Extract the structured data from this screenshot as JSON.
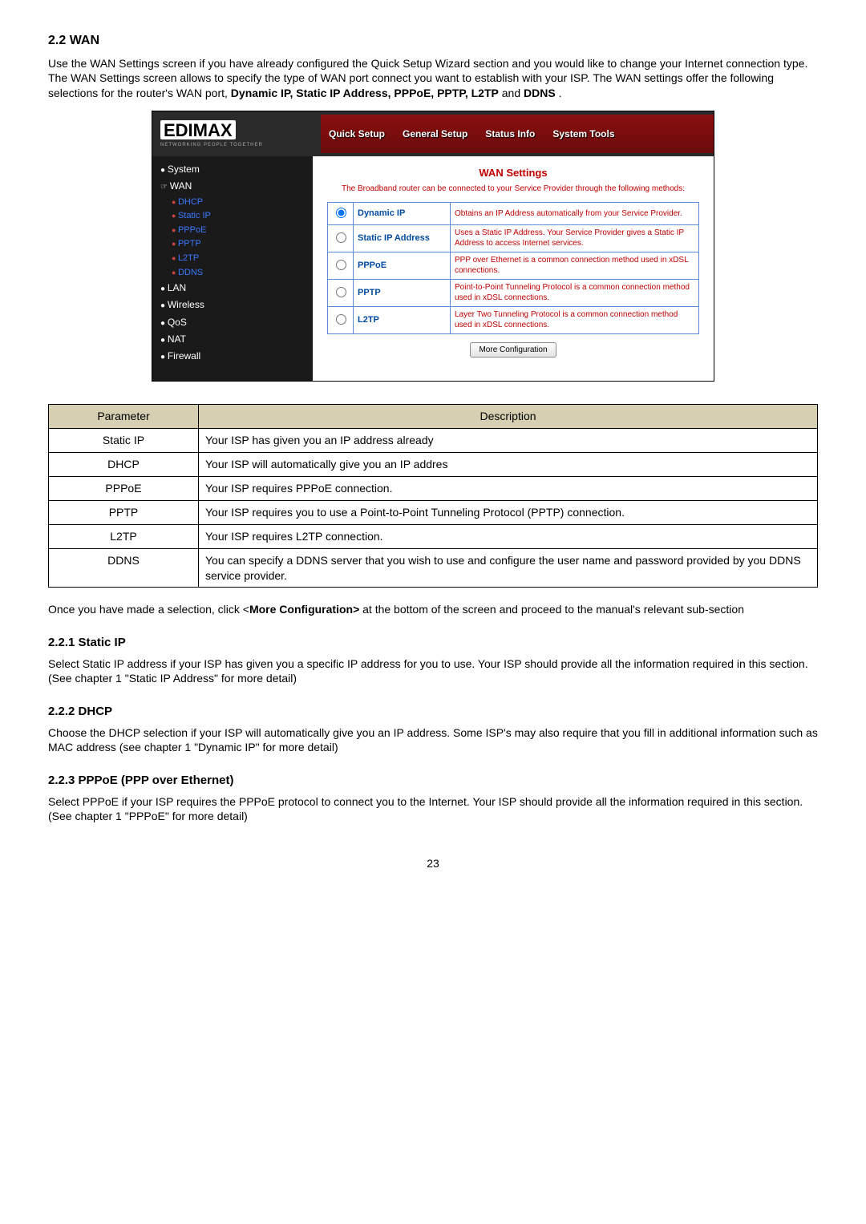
{
  "headings": {
    "wan": "2.2 WAN",
    "static_ip": "2.2.1 Static IP",
    "dhcp": "2.2.2 DHCP",
    "pppoe": "2.2.3 PPPoE (PPP over Ethernet)"
  },
  "paragraphs": {
    "wan_intro_1": "Use the WAN Settings screen if you have already configured the Quick Setup Wizard section and you would like to change your Internet connection type. The WAN Settings screen allows to specify the type of WAN port connect you want to establish with your ISP. The WAN settings offer the following selections for the router's WAN port, ",
    "wan_intro_bold": "Dynamic IP, Static IP Address, PPPoE, PPTP, L2TP",
    "wan_intro_and": " and ",
    "wan_intro_ddns": "DDNS",
    "wan_intro_end": ".",
    "after_table_1": "Once you have made a selection, click <",
    "after_table_bold": "More Configuration>",
    "after_table_2": " at the bottom of the screen and proceed to the manual's relevant sub-section",
    "static_ip_text": "Select Static IP address if your ISP has given you a specific IP address for you to use. Your ISP should provide all the information required in this section. (See chapter 1 \"Static IP Address\" for more detail)",
    "dhcp_text": "Choose the DHCP selection if your ISP will automatically give you an IP address. Some ISP's may also require that you fill in additional information such as MAC address (see chapter 1 \"Dynamic IP\" for more detail)",
    "pppoe_text": "Select PPPoE if your ISP requires the PPPoE protocol to connect you to the Internet. Your ISP should provide all the information required in this section. (See chapter 1 \"PPPoE\" for more detail)"
  },
  "router_ui": {
    "logo_main": "EDIMAX",
    "logo_sub": "NETWORKING PEOPLE TOGETHER",
    "topnav": [
      "Quick Setup",
      "General Setup",
      "Status Info",
      "System Tools"
    ],
    "sidebar": {
      "system": "System",
      "wan": "WAN",
      "subs": [
        "DHCP",
        "Static IP",
        "PPPoE",
        "PPTP",
        "L2TP",
        "DDNS"
      ],
      "lan": "LAN",
      "wireless": "Wireless",
      "qos": "QoS",
      "nat": "NAT",
      "firewall": "Firewall"
    },
    "panel": {
      "title": "WAN Settings",
      "subtitle": "The Broadband router can be connected to your Service Provider through the following methods:",
      "rows": [
        {
          "label": "Dynamic IP",
          "desc": "Obtains an IP Address automatically from your Service Provider.",
          "checked": true
        },
        {
          "label": "Static IP Address",
          "desc": "Uses a Static IP Address. Your Service Provider gives a Static IP Address to access Internet services.",
          "checked": false
        },
        {
          "label": "PPPoE",
          "desc": "PPP over Ethernet is a common connection method used in xDSL connections.",
          "checked": false
        },
        {
          "label": "PPTP",
          "desc": "Point-to-Point Tunneling Protocol is a common connection method used in xDSL connections.",
          "checked": false
        },
        {
          "label": "L2TP",
          "desc": "Layer Two Tunneling Protocol is a common connection method used in xDSL connections.",
          "checked": false
        }
      ],
      "button": "More Configuration"
    }
  },
  "param_table": {
    "headers": {
      "param": "Parameter",
      "desc": "Description"
    },
    "rows": [
      {
        "param": "Static IP",
        "desc": "Your ISP has given you an IP address already"
      },
      {
        "param": "DHCP",
        "desc": "Your ISP will automatically give you an IP addres"
      },
      {
        "param": "PPPoE",
        "desc": "Your ISP requires PPPoE connection."
      },
      {
        "param": "PPTP",
        "desc": "Your ISP requires you to use a Point-to-Point Tunneling Protocol (PPTP) connection."
      },
      {
        "param": "L2TP",
        "desc": "Your ISP requires L2TP connection."
      },
      {
        "param": "DDNS",
        "desc": "You can specify a DDNS server that you wish to use and configure the user name and password provided by you DDNS service provider."
      }
    ]
  },
  "page_number": "23"
}
